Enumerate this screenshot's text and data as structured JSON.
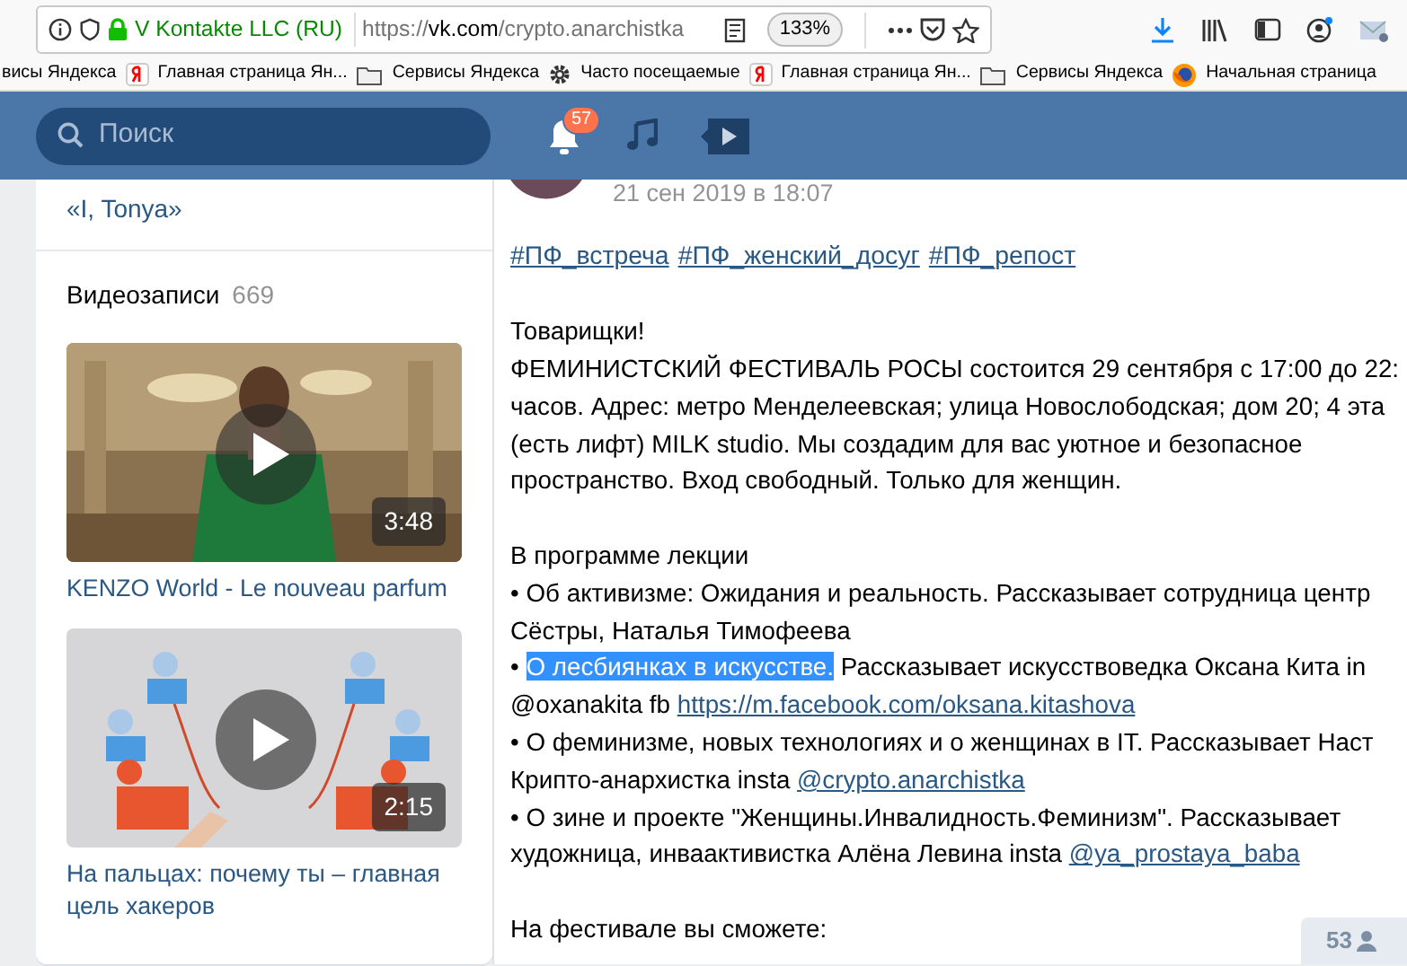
{
  "browser": {
    "site_identity": "V Kontakte LLC (RU)",
    "url_scheme": "https://",
    "url_host": "vk.com",
    "url_path": "/crypto.anarchistka",
    "zoom": "133%"
  },
  "bookmarks": [
    {
      "label": "висы Яндекса",
      "kind": "plain"
    },
    {
      "label": "Главная страница Ян...",
      "kind": "yandex"
    },
    {
      "label": "Сервисы Яндекса",
      "kind": "folder"
    },
    {
      "label": "Часто посещаемые",
      "kind": "gear"
    },
    {
      "label": "Главная страница Ян...",
      "kind": "yandex"
    },
    {
      "label": "Сервисы Яндекса",
      "kind": "folder"
    },
    {
      "label": "Начальная страница",
      "kind": "browser"
    }
  ],
  "header": {
    "search_placeholder": "Поиск",
    "notifications_count": "57"
  },
  "sidebar": {
    "top_link": "«I, Tonya»",
    "videos_title": "Видеозаписи",
    "videos_count": "669",
    "videos": [
      {
        "duration": "3:48",
        "title": "KENZO World - Le nouveau parfum"
      },
      {
        "duration": "2:15",
        "title": "На пальцах: почему ты – главная цель хакеров"
      }
    ]
  },
  "post": {
    "date": "21 сен 2019 в 18:07",
    "hashtags": [
      "#ПФ_встреча",
      "#ПФ_женский_досуг",
      "#ПФ_репост"
    ],
    "lines": [
      {
        "gap_before": false,
        "segments": [
          {
            "kind": "text",
            "text": "Товарищки!"
          }
        ]
      },
      {
        "gap_before": false,
        "segments": [
          {
            "kind": "text",
            "text": "ФЕМИНИСТСКИЙ ФЕСТИВАЛЬ РОСЫ состоится 29 сентября с 17:00 до 22:"
          }
        ]
      },
      {
        "gap_before": false,
        "segments": [
          {
            "kind": "text",
            "text": "часов. Адрес: метро Менделеевская; улица Новослободская; дом 20; 4 эта"
          }
        ]
      },
      {
        "gap_before": false,
        "segments": [
          {
            "kind": "text",
            "text": "(есть лифт) MILK studio. Мы создадим для вас уютное и безопасное"
          }
        ]
      },
      {
        "gap_before": false,
        "segments": [
          {
            "kind": "text",
            "text": "пространство. Вход свободный. Только для женщин."
          }
        ]
      },
      {
        "gap_before": true,
        "segments": [
          {
            "kind": "text",
            "text": "В программе лекции"
          }
        ]
      },
      {
        "gap_before": false,
        "segments": [
          {
            "kind": "text",
            "text": "• Об активизме: Ожидания и реальность. Рассказывает сотрудница центр"
          }
        ]
      },
      {
        "gap_before": false,
        "segments": [
          {
            "kind": "text",
            "text": "Сёстры, Наталья Тимофеева"
          }
        ]
      },
      {
        "gap_before": false,
        "segments": [
          {
            "kind": "text",
            "text": "• "
          },
          {
            "kind": "highlight",
            "text": "О лесбиянках в искусстве."
          },
          {
            "kind": "text",
            "text": " Рассказывает искусствоведка Оксана Кита in"
          }
        ]
      },
      {
        "gap_before": false,
        "segments": [
          {
            "kind": "text",
            "text": "@oxanakita fb "
          },
          {
            "kind": "link",
            "text": "https://m.facebook.com/oksana.kitashova"
          }
        ]
      },
      {
        "gap_before": false,
        "segments": [
          {
            "kind": "text",
            "text": "• О феминизме, новых технологиях и о женщинах в IT. Рассказывает Наст"
          }
        ]
      },
      {
        "gap_before": false,
        "segments": [
          {
            "kind": "text",
            "text": "Крипто-анархистка insta "
          },
          {
            "kind": "link",
            "text": "@crypto.anarchistka"
          }
        ]
      },
      {
        "gap_before": false,
        "segments": [
          {
            "kind": "text",
            "text": "• О зине и проекте \"Женщины.Инвалидность.Феминизм\". Рассказывает"
          }
        ]
      },
      {
        "gap_before": false,
        "segments": [
          {
            "kind": "text",
            "text": "художница, инваактивистка Алёна Левина insta "
          },
          {
            "kind": "link",
            "text": "@ya_prostaya_baba"
          }
        ]
      },
      {
        "gap_before": true,
        "segments": [
          {
            "kind": "text",
            "text": "На фестивале вы сможете:"
          }
        ]
      }
    ],
    "views": "53"
  }
}
